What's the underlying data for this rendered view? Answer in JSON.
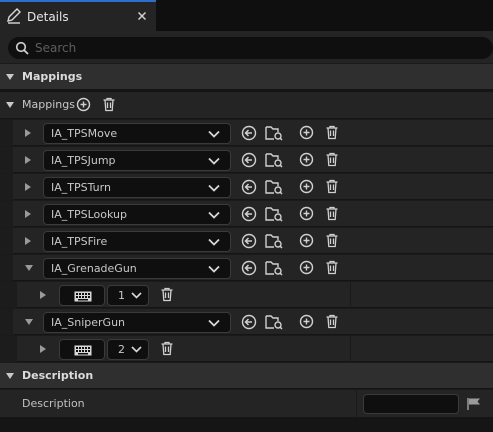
{
  "tab": {
    "title": "Details",
    "icon": "pencil-icon",
    "close_icon": "close-icon"
  },
  "search": {
    "placeholder": "Search",
    "value": ""
  },
  "categories": {
    "mappings": "Mappings",
    "description": "Description"
  },
  "mappings_array": {
    "label": "Mappings",
    "add_icon": "add-element-icon",
    "clear_icon": "trash-icon"
  },
  "actions": [
    {
      "name": "IA_TPSMove"
    },
    {
      "name": "IA_TPSJump"
    },
    {
      "name": "IA_TPSTurn"
    },
    {
      "name": "IA_TPSLookup"
    },
    {
      "name": "IA_TPSFire"
    },
    {
      "name": "IA_GrenadeGun",
      "expanded": true,
      "key_icon": "keyboard-icon",
      "key_value": "1"
    },
    {
      "name": "IA_SniperGun",
      "expanded": true,
      "key_icon": "keyboard-icon",
      "key_value": "2"
    }
  ],
  "description_row": {
    "label": "Description",
    "value": ""
  },
  "colors": {
    "accent": "#2b6fd1",
    "panel": "#242424",
    "header": "#2f2f2f",
    "input": "#0f0f0f",
    "text": "#c8c8c8"
  }
}
